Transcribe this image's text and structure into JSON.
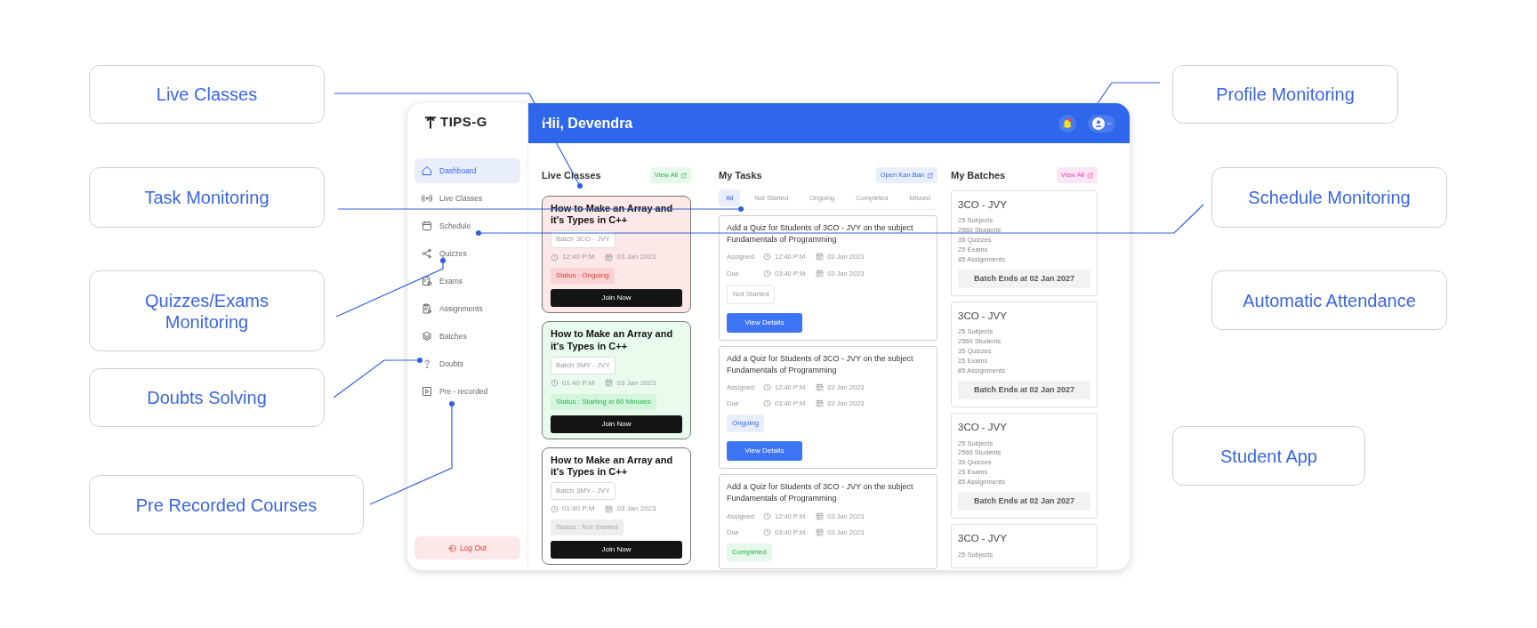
{
  "callouts": [
    {
      "label": "Live Classes"
    },
    {
      "label": "Task Monitoring"
    },
    {
      "label": "Quizzes/Exams Monitoring"
    },
    {
      "label": "Doubts Solving"
    },
    {
      "label": "Pre Recorded Courses"
    },
    {
      "label": "Profile Monitoring"
    },
    {
      "label": "Schedule Monitoring"
    },
    {
      "label": "Automatic Attendance"
    },
    {
      "label": "Student App"
    }
  ],
  "app": {
    "logo": "TIPS-G",
    "sidebar": {
      "items": [
        {
          "label": "Dashboard",
          "selected": true
        },
        {
          "label": "Live Classes",
          "selected": false
        },
        {
          "label": "Schedule",
          "selected": false
        },
        {
          "label": "Quizzes",
          "selected": false
        },
        {
          "label": "Exams",
          "selected": false
        },
        {
          "label": "Assignments",
          "selected": false
        },
        {
          "label": "Batches",
          "selected": false
        },
        {
          "label": "Doubts",
          "selected": false
        },
        {
          "label": "Pre - recorded",
          "selected": false
        }
      ],
      "logout": "Log Out"
    },
    "header": {
      "greeting": "Hii, Devendra",
      "unread": true
    },
    "live_classes": {
      "title": "Live Classes",
      "view_all": "View All",
      "cards": [
        {
          "title": "How to Make an Array and it's Types in C++",
          "batch": "Batch 3CO - JVY",
          "time": "12:40 P:M",
          "date": "03 Jan 2023",
          "status": "Status : Ongoing",
          "kind": "ongoing",
          "button": "Join Now"
        },
        {
          "title": "How to Make an Array and it's Types in C++",
          "batch": "Batch 3MY - JVY",
          "time": "01:40 P:M",
          "date": "03 Jan 2023",
          "status": "Status : Starting in 60 Minutes",
          "kind": "upcoming",
          "button": "Join Now"
        },
        {
          "title": "How to Make an Array and it's Types in C++",
          "batch": "Batch 3MY - JVY",
          "time": "01:40 P:M",
          "date": "03 Jan 2023",
          "status": "Status : Not Started",
          "kind": "not_started",
          "button": "Join Now"
        }
      ]
    },
    "tasks": {
      "title": "My Tasks",
      "open_button": "Open Kan Ban",
      "tabs": [
        {
          "label": "All",
          "selected": true
        },
        {
          "label": "Not Started",
          "selected": false
        },
        {
          "label": "Ongoing",
          "selected": false
        },
        {
          "label": "Completed",
          "selected": false
        },
        {
          "label": "Missed",
          "selected": false
        }
      ],
      "cards": [
        {
          "title": "Add a Quiz for Students of 3CO - JVY on the subject Fundamentals of Programming",
          "assigned_label": "Assigned",
          "assigned_time": "12:40 P:M",
          "assigned_date": "03 Jan 2023",
          "due_label": "Due",
          "due_time": "03:40 P:M",
          "due_date": "03 Jan 2023",
          "status": "Not Started",
          "kind": "not_started",
          "button": "View Details"
        },
        {
          "title": "Add a Quiz for Students of 3CO - JVY on the subject Fundamentals of Programming",
          "assigned_label": "Assigned",
          "assigned_time": "12:40 P:M",
          "assigned_date": "03 Jan 2023",
          "due_label": "Due",
          "due_time": "03:40 P:M",
          "due_date": "03 Jan 2023",
          "status": "Ongoing",
          "kind": "ongoing",
          "button": "View Details"
        },
        {
          "title": "Add a Quiz for Students of 3CO - JVY on the subject Fundamentals of Programming",
          "assigned_label": "Assigned",
          "assigned_time": "12:40 P:M",
          "assigned_date": "03 Jan 2023",
          "due_label": "Due",
          "due_time": "03:40 P:M",
          "due_date": "03 Jan 2023",
          "status": "Completed",
          "kind": "completed"
        }
      ]
    },
    "batches": {
      "title": "My Batches",
      "view_all": "View All",
      "cards": [
        {
          "name": "3CO - JVY",
          "stats": [
            "25 Subjects",
            "2560 Students",
            "35 Quizzes",
            "25 Exams",
            "85 Assignments"
          ],
          "ends": "Batch Ends at 02 Jan 2027"
        },
        {
          "name": "3CO - JVY",
          "stats": [
            "25 Subjects",
            "2560 Students",
            "35 Quizzes",
            "25 Exams",
            "85 Assignments"
          ],
          "ends": "Batch Ends at 02 Jan 2027"
        },
        {
          "name": "3CO - JVY",
          "stats": [
            "25 Subjects",
            "2560 Students",
            "35 Quizzes",
            "25 Exams",
            "85 Assignments"
          ],
          "ends": "Batch Ends at 02 Jan 2027"
        },
        {
          "name": "3CO - JVY",
          "stats": [
            "25 Subjects"
          ]
        }
      ]
    }
  }
}
